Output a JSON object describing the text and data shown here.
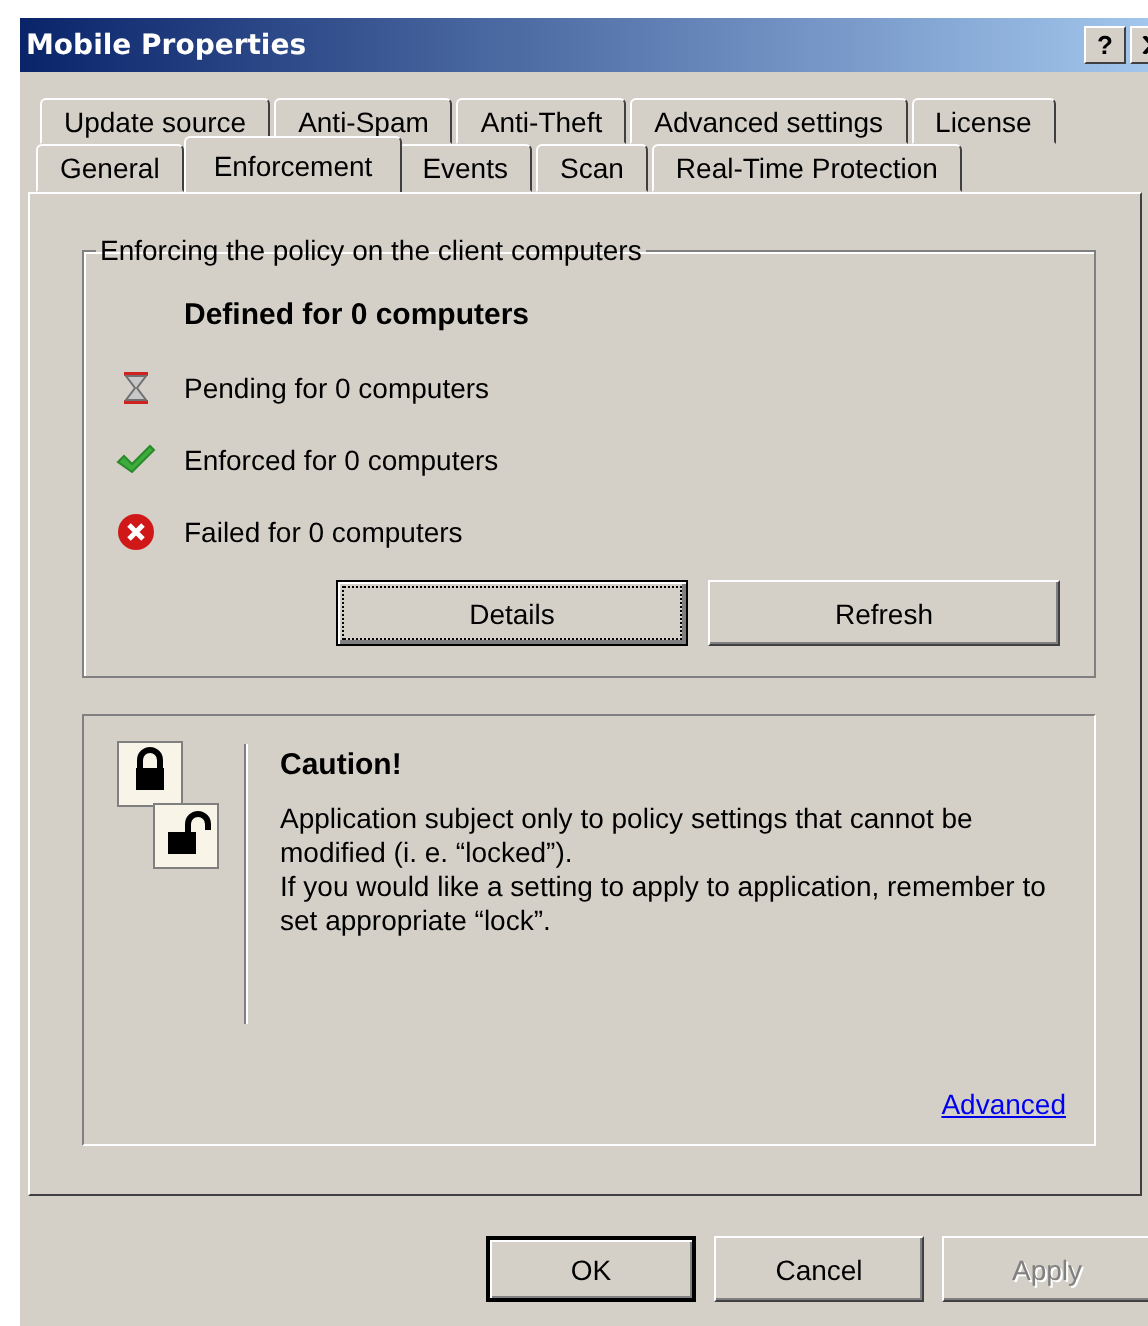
{
  "window": {
    "title": "Mobile Properties",
    "help": "?"
  },
  "tab_rows": [
    [
      {
        "label": "Update source",
        "selected": false
      },
      {
        "label": "Anti-Spam",
        "selected": false
      },
      {
        "label": "Anti-Theft",
        "selected": false
      },
      {
        "label": "Advanced settings",
        "selected": false
      },
      {
        "label": "License",
        "selected": false
      }
    ],
    [
      {
        "label": "General",
        "selected": false
      },
      {
        "label": "Enforcement",
        "selected": true
      },
      {
        "label": "Events",
        "selected": false
      },
      {
        "label": "Scan",
        "selected": false
      },
      {
        "label": "Real-Time Protection",
        "selected": false
      }
    ]
  ],
  "enforcement": {
    "legend": "Enforcing the policy on the client computers",
    "heading": "Defined for 0 computers",
    "statuses": [
      {
        "kind": "pending",
        "text": "Pending for 0 computers"
      },
      {
        "kind": "enforced",
        "text": "Enforced for 0 computers"
      },
      {
        "kind": "failed",
        "text": "Failed for 0 computers"
      }
    ],
    "buttons": [
      {
        "label": "Details",
        "focused": true
      },
      {
        "label": "Refresh",
        "focused": false
      }
    ]
  },
  "caution": {
    "title": "Caution!",
    "lines": [
      "Application subject only to policy settings that cannot be modified (i. e. “locked”).",
      "If you would like a setting to apply to application, remember to set appropriate “lock”."
    ],
    "link": "Advanced"
  },
  "buttons": [
    {
      "label": "OK",
      "default": true,
      "disabled": false
    },
    {
      "label": "Cancel",
      "default": false,
      "disabled": false
    },
    {
      "label": "Apply",
      "default": false,
      "disabled": true
    }
  ]
}
